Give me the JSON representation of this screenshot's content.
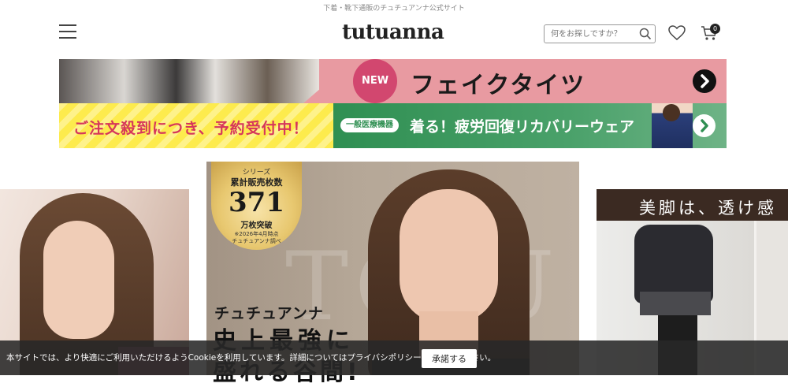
{
  "header": {
    "tagline": "下着・靴下通販のチュチュアンナ公式サイト",
    "logo": "tutuanna",
    "search": {
      "placeholder": "何をお探しですか？",
      "value": ""
    },
    "cart_count": "0",
    "icons": [
      "menu-icon",
      "search-icon",
      "heart-icon",
      "cart-icon"
    ]
  },
  "banners": {
    "fake_tights": {
      "badge": "NEW",
      "title": "フェイクタイツ"
    },
    "order_banner": {
      "text": "ご注文殺到につき、予約受付中！"
    },
    "recovery_banner": {
      "badge": "一般医療機器",
      "text": "着る！疲労回復リカバリーウェア"
    }
  },
  "carousel": {
    "center": {
      "medal": {
        "line1": "シリーズ",
        "line2": "累計販売枚数",
        "number": "371",
        "line3": "万枚突破",
        "line4": "※2026年4月時点",
        "line5": "チュチュアンナ調べ"
      },
      "subtitle": "チュチュアンナ",
      "headline": "史上最強に",
      "headline2": "盛れる谷間!"
    },
    "right": {
      "title": "美脚は、透け感"
    }
  },
  "cookie": {
    "message": "本サイトでは、より快適にご利用いただけるようCookieを利用しています。詳細についてはプライバシポリシーをご確認ください。",
    "accept_label": "承諾する"
  },
  "colors": {
    "pink_banner": "#e89aa1",
    "new_badge": "#d2476f",
    "yellow_banner": "#fdeb4d",
    "order_text": "#d6365b",
    "green_banner": "#2f8f52"
  }
}
